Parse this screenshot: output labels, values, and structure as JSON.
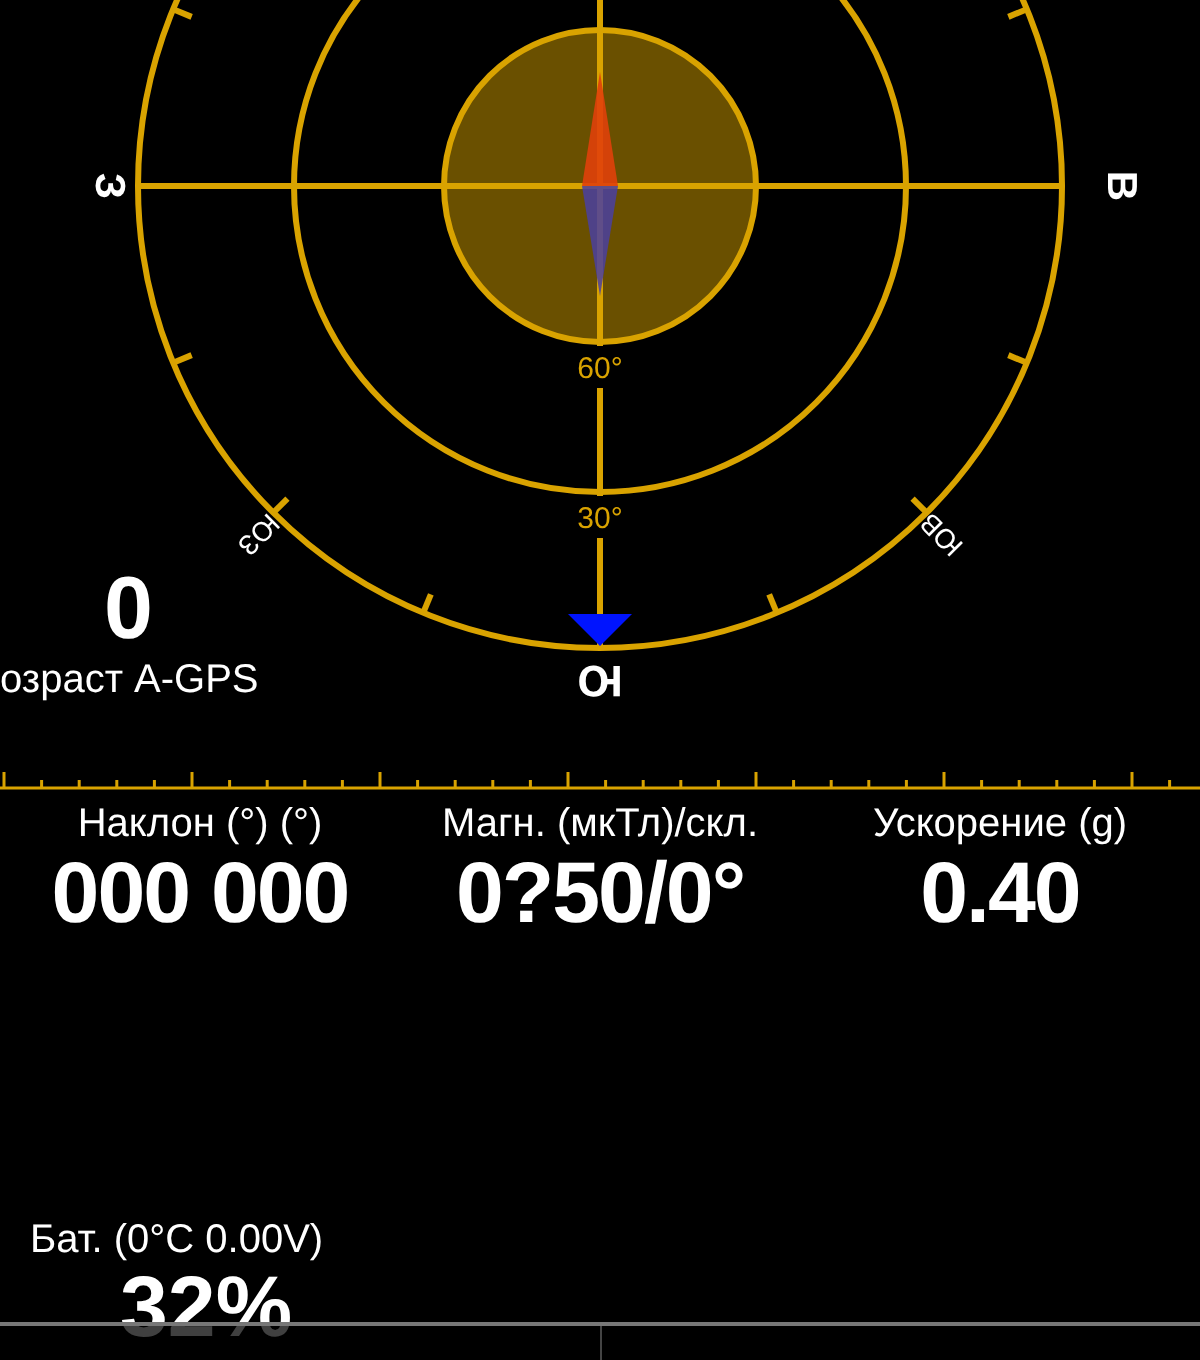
{
  "compass": {
    "west": "З",
    "east": "В",
    "south": "Ю",
    "southwest": "ЮЗ",
    "southeast": "ЮВ",
    "rings": [
      "60°",
      "30°"
    ]
  },
  "agps": {
    "value": "0",
    "label": "озраст A-GPS"
  },
  "readouts": [
    {
      "label": "Наклон (°) (°)",
      "value": "000 000"
    },
    {
      "label": "Магн. (мкТл)/скл.",
      "value": "0?50/0°"
    },
    {
      "label": "Ускорение (g)",
      "value": "0.40"
    }
  ],
  "battery": {
    "label": "Бат. (0°C 0.00V)",
    "value": "32%"
  }
}
